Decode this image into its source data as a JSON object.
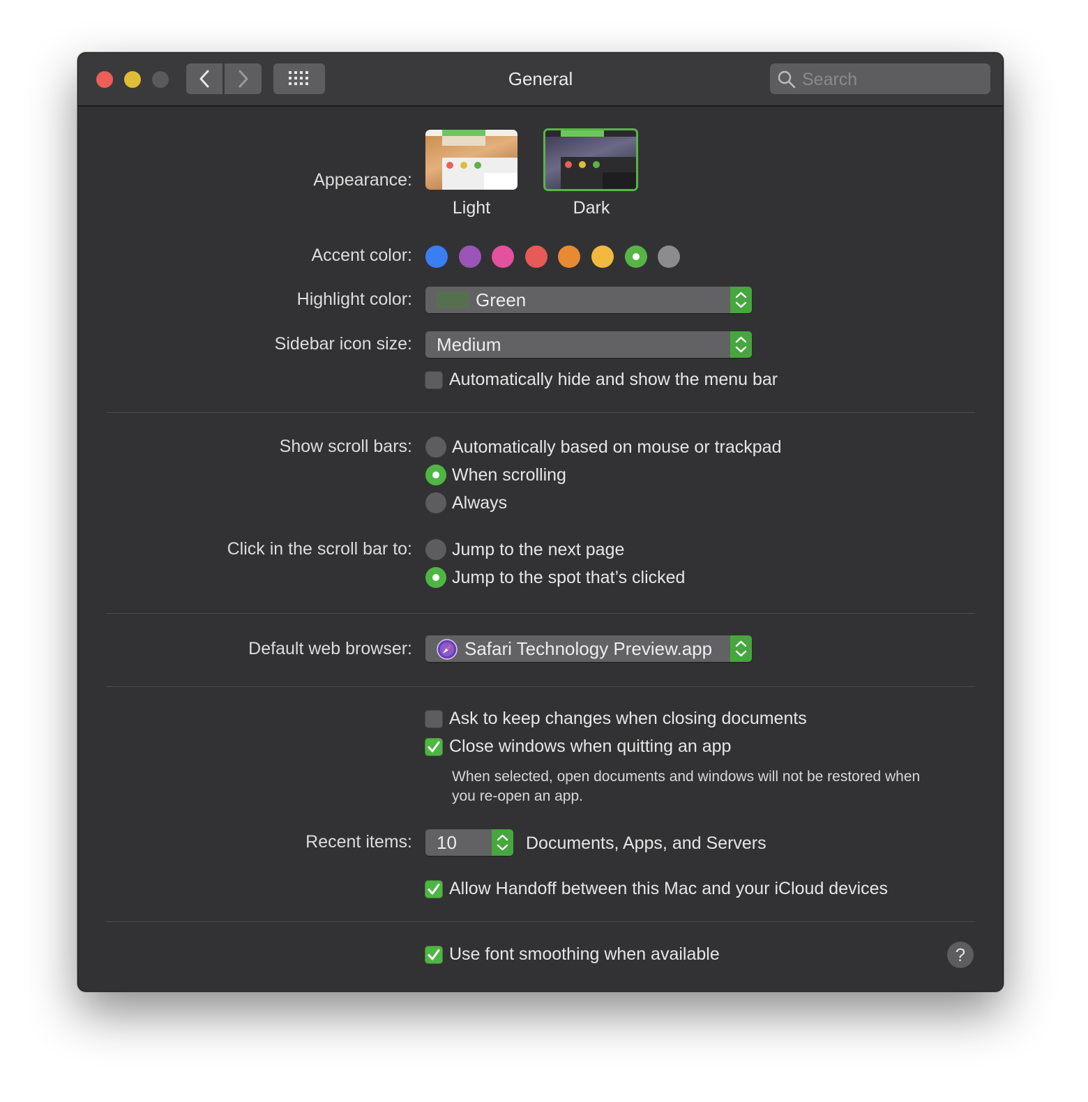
{
  "window": {
    "title": "General",
    "search_placeholder": "Search"
  },
  "appearance": {
    "label": "Appearance:",
    "options": [
      {
        "label": "Light",
        "selected": false
      },
      {
        "label": "Dark",
        "selected": true
      }
    ]
  },
  "accent": {
    "label": "Accent color:",
    "colors": [
      "#3b7df3",
      "#9a55b6",
      "#e4519c",
      "#e85a57",
      "#e98a33",
      "#f2b940",
      "#59b447",
      "#8c8c8c"
    ],
    "selected_index": 6
  },
  "highlight": {
    "label": "Highlight color:",
    "value": "Green",
    "swatch": "#56704f"
  },
  "sidebar_icon": {
    "label": "Sidebar icon size:",
    "value": "Medium"
  },
  "menu_bar": {
    "label": "Automatically hide and show the menu bar",
    "checked": false
  },
  "scroll_bars": {
    "label": "Show scroll bars:",
    "options": [
      {
        "label": "Automatically based on mouse or trackpad",
        "selected": false
      },
      {
        "label": "When scrolling",
        "selected": true
      },
      {
        "label": "Always",
        "selected": false
      }
    ]
  },
  "click_scroll": {
    "label": "Click in the scroll bar to:",
    "options": [
      {
        "label": "Jump to the next page",
        "selected": false
      },
      {
        "label": "Jump to the spot that’s clicked",
        "selected": true
      }
    ]
  },
  "browser": {
    "label": "Default web browser:",
    "value": "Safari Technology Preview.app"
  },
  "documents": {
    "ask_keep": {
      "label": "Ask to keep changes when closing documents",
      "checked": false
    },
    "close_windows": {
      "label": "Close windows when quitting an app",
      "checked": true
    },
    "note": "When selected, open documents and windows will not be restored when you re-open an app."
  },
  "recent": {
    "label": "Recent items:",
    "value": "10",
    "suffix": "Documents, Apps, and Servers"
  },
  "handoff": {
    "label": "Allow Handoff between this Mac and your iCloud devices",
    "checked": true
  },
  "font_smoothing": {
    "label": "Use font smoothing when available",
    "checked": true
  },
  "help": "?",
  "colors": {
    "accent_green": "#4fb544",
    "window_bg": "#323234",
    "titlebar_bg": "#3a3a3c"
  }
}
